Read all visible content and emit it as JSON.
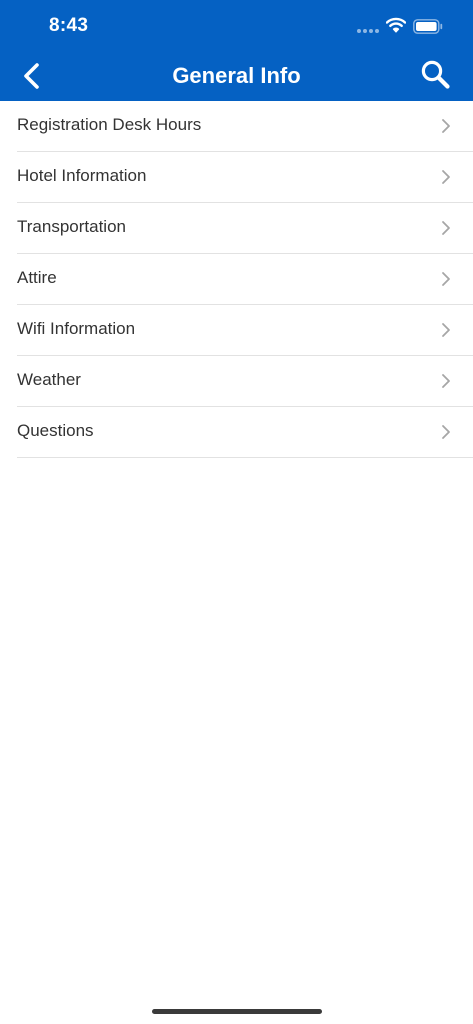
{
  "status_bar": {
    "time": "8:43",
    "signal_icon": "cellular-dots-icon",
    "wifi_icon": "wifi-icon",
    "battery_icon": "battery-icon"
  },
  "header": {
    "title": "General Info",
    "back_icon": "chevron-left-icon",
    "search_icon": "search-icon",
    "background_color": "#0561c3"
  },
  "menu": {
    "items": [
      {
        "label": "Registration Desk Hours"
      },
      {
        "label": "Hotel Information"
      },
      {
        "label": "Transportation"
      },
      {
        "label": "Attire"
      },
      {
        "label": "Wifi Information"
      },
      {
        "label": "Weather"
      },
      {
        "label": "Questions"
      }
    ],
    "item_icon": "chevron-right-icon"
  }
}
